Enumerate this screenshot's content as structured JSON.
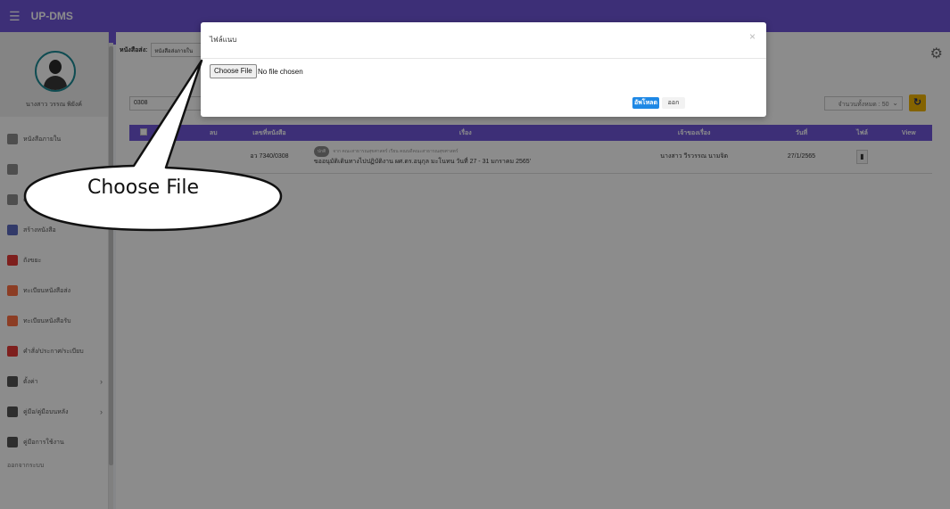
{
  "app": {
    "title": "UP-DMS"
  },
  "sidebar": {
    "user_name": "นางสาว วรรณ พิยังค์",
    "items": [
      {
        "label": "หนังสือภายใน",
        "icon": "inbox-icon",
        "color": "#8e8e8e"
      },
      {
        "label": "",
        "icon": "outbox-icon",
        "color": "#8e8e8e"
      },
      {
        "label": "ค",
        "icon": "document-icon",
        "color": "#8e8e8e"
      },
      {
        "label": "สร้างหนังสือ",
        "icon": "create-document-icon",
        "color": "#5c6bc0"
      },
      {
        "label": "ถังขยะ",
        "icon": "trash-icon",
        "color": "#e53935"
      },
      {
        "label": "ทะเบียนหนังสือส่ง",
        "icon": "send-register-icon",
        "color": "#ff7043"
      },
      {
        "label": "ทะเบียนหนังสือรับ",
        "icon": "receive-register-icon",
        "color": "#ff7043"
      },
      {
        "label": "คำสั่ง/ประกาศ/ระเบียบ",
        "icon": "book-icon",
        "color": "#e53935"
      },
      {
        "label": "ตั้งค่า",
        "icon": "settings-icon",
        "color": "#555555",
        "has_arrow": true
      },
      {
        "label": "คู่มือ/คู่มือบนหลัง",
        "icon": "layers-icon",
        "color": "#555555",
        "has_arrow": true
      },
      {
        "label": "คู่มือการใช้งาน",
        "icon": "manual-icon",
        "color": "#555555"
      }
    ],
    "logout_label": "ออกจากระบบ"
  },
  "main": {
    "filter_label": "หนังสือส่ง:",
    "filter_value": "หนังสือส่งภายใน",
    "search_value": "0308",
    "count_label": "จำนวนทั้งหมด : 50",
    "table": {
      "headers": [
        "",
        "",
        "ลบ",
        "เลขที่หนังสือ",
        "เรื่อง",
        "เจ้าของเรื่อง",
        "วันที่",
        "ไฟล์",
        "View"
      ],
      "rows": [
        {
          "doc_no": "อว 7340/0308",
          "tag": "ปกติ",
          "from_line": "จาก คณะสาธารณสุขศาสตร์ เรียน คณบดีคณะสาธารณสุขศาสตร์",
          "subject": "ขออนุมัติเดินทางไปปฏิบัติงาน ผศ.ดร.อนุกุล มะโนทน วันที่ 27 - 31 มกราคม 2565'",
          "owner": "นางสาว วีรวรรณ นามจิต",
          "date": "27/1/2565"
        }
      ]
    }
  },
  "modal": {
    "title": "ไฟล์แนบ",
    "choose_file_label": "Choose File",
    "file_status": "No file chosen",
    "upload_label": "อัพโหลด",
    "exit_label": "ออก"
  },
  "callout": {
    "text": "Choose File"
  },
  "colors": {
    "header": "#6f56d9",
    "upload": "#1e88e5",
    "refresh": "#f0b400"
  }
}
